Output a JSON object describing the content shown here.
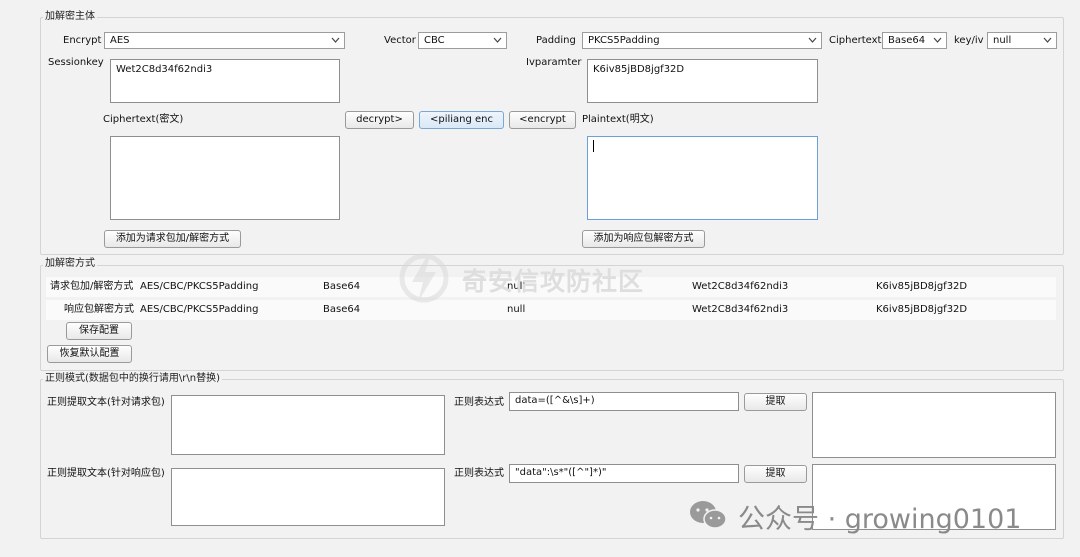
{
  "crypto_group": {
    "legend": "加解密主体",
    "encrypt_label": "Encrypt",
    "encrypt_value": "AES",
    "vector_label": "Vector",
    "vector_value": "CBC",
    "padding_label": "Padding",
    "padding_value": "PKCS5Padding",
    "ciphertext_label": "Ciphertext",
    "ciphertext_value": "Base64",
    "keyiv_label": "key/iv",
    "keyiv_value": "null",
    "sessionkey_label": "Sessionkey",
    "sessionkey_value": "Wet2C8d34f62ndi3",
    "ivparam_label": "Ivparamter",
    "ivparam_value": "K6iv85jBD8jgf32D",
    "cipher_text_label": "Ciphertext(密文)",
    "plain_text_label": "Plaintext(明文)",
    "decrypt_button": "decrypt>",
    "piliang_button": "<piliang enc",
    "encrypt_button": "<encrypt",
    "add_request_button": "添加为请求包加/解密方式",
    "add_response_button": "添加为响应包解密方式"
  },
  "methods_group": {
    "legend": "加解密方式",
    "rows": [
      {
        "label": "请求包加/解密方式",
        "algo": "AES/CBC/PKCS5Padding",
        "encoding": "Base64",
        "keyiv": "null",
        "key": "Wet2C8d34f62ndi3",
        "iv": "K6iv85jBD8jgf32D"
      },
      {
        "label": "响应包解密方式",
        "algo": "AES/CBC/PKCS5Padding",
        "encoding": "Base64",
        "keyiv": "null",
        "key": "Wet2C8d34f62ndi3",
        "iv": "K6iv85jBD8jgf32D"
      }
    ],
    "save_button": "保存配置",
    "restore_button": "恢复默认配置"
  },
  "regex_group": {
    "legend": "正则模式(数据包中的换行请用\\r\\n替换)",
    "req_label": "正则提取文本(针对请求包)",
    "resp_label": "正则提取文本(针对响应包)",
    "expr_label_1": "正则表达式",
    "expr_value_1": "data=([^&\\s]+)",
    "expr_label_2": "正则表达式",
    "expr_value_2": "\"data\":\\s*\"([^\"]*)\"",
    "extract_button_1": "提取",
    "extract_button_2": "提取"
  },
  "watermarks": {
    "center": "奇安信攻防社区",
    "bottom": "公众号 · growing0101"
  }
}
